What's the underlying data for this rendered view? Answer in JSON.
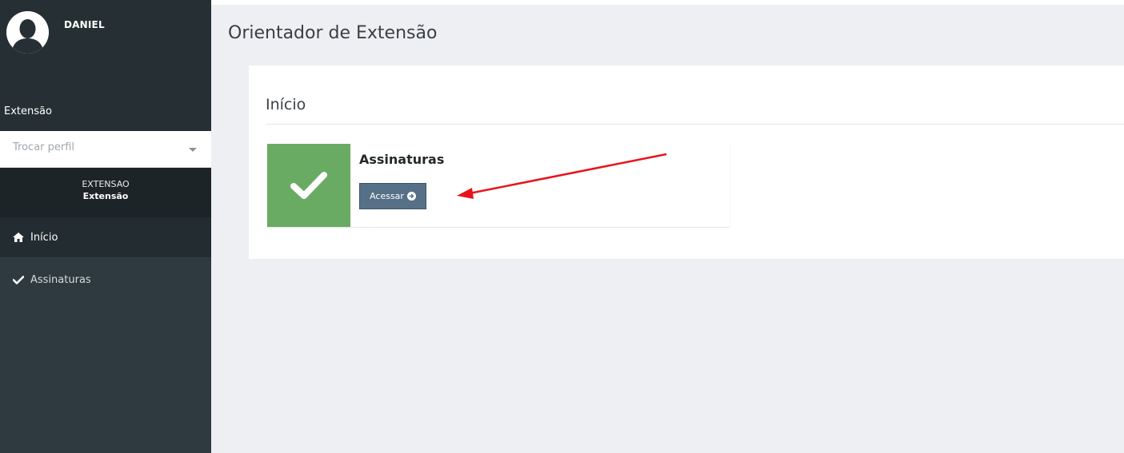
{
  "sidebar": {
    "user_name": "DANIEL",
    "section_label": "Extensão",
    "profile_select_placeholder": "Trocar perfil",
    "profile_code": "EXTENSAO",
    "profile_name": "Extensão",
    "items": [
      {
        "label": "Início",
        "icon": "home-icon",
        "active": true
      },
      {
        "label": "Assinaturas",
        "icon": "check-icon",
        "active": false
      }
    ]
  },
  "main": {
    "page_title": "Orientador de Extensão",
    "panel_heading": "Início",
    "info_box": {
      "title": "Assinaturas",
      "button_label": "Acessar",
      "icon": "check-icon"
    }
  },
  "colors": {
    "sidebar_bg": "#2f3a40",
    "info_icon_bg": "#6aab63",
    "button_bg": "#567087",
    "annotation_arrow": "#e8141d"
  }
}
